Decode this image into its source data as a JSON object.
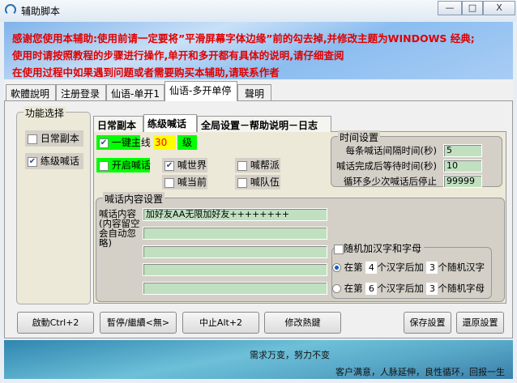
{
  "window": {
    "title": "辅助脚本",
    "minimize": "—",
    "maximize": "□",
    "close": "X"
  },
  "banner": {
    "lines": [
      "感谢您使用本辅助:使用前请一定要将”平滑屏幕字体边缘”前的勾去掉,并修改主题为WINDOWS 经典;",
      "使用时请按照教程的步骤进行操作,单开和多开都有具体的说明,请仔细查阅",
      "在使用过程中如果遇到问题或者需要购买本辅助,请联系作者"
    ]
  },
  "tabs": [
    "軟體說明",
    "注册登录",
    "仙语-单开1",
    "仙语-多开单停",
    "聲明"
  ],
  "func_group": {
    "title": "功能选择",
    "items": [
      {
        "label": "日常副本",
        "checked": false
      },
      {
        "label": "练级喊话",
        "checked": true
      }
    ]
  },
  "inner_tabs": [
    "日常副本",
    "练级喊话",
    "全局设置－帮助说明－日志"
  ],
  "leveling": {
    "main_quest_label": "一键主线",
    "main_quest_checked": true,
    "level_value": "30",
    "level_unit": "级"
  },
  "shout": {
    "enable_label": "开启喊话",
    "enable_checked": false,
    "world": {
      "label": "喊世界",
      "checked": true
    },
    "guild": {
      "label": "喊帮派",
      "checked": false
    },
    "current": {
      "label": "喊当前",
      "checked": false
    },
    "team": {
      "label": "喊队伍",
      "checked": false
    }
  },
  "time_settings": {
    "title": "时间设置",
    "interval_label": "每条喊话间隔时间(秒)",
    "interval_value": "5",
    "wait_label": "喊话完成后等待时间(秒)",
    "wait_value": "10",
    "loop_label": "循环多少次喊话后停止",
    "loop_value": "99999"
  },
  "content_settings": {
    "title": "喊话内容设置",
    "label": "喊话内容(内容留空会自动忽略)",
    "lines": [
      "加好友AA无限加好友++++++++",
      "",
      "",
      "",
      ""
    ]
  },
  "random": {
    "title": "随机加汉字和字母",
    "checked": false,
    "opt1": {
      "prefix": "在第",
      "pos": "4",
      "mid": "个汉字后加",
      "count": "3",
      "suffix": "个随机汉字",
      "selected": true
    },
    "opt2": {
      "prefix": "在第",
      "pos": "6",
      "mid": "个汉字后加",
      "count": "3",
      "suffix": "个随机字母",
      "selected": false
    }
  },
  "buttons": {
    "start": "啟動Ctrl+2",
    "pause": "暫停/繼續<無>",
    "stop": "中止Alt+2",
    "hotkey": "修改熱鍵",
    "save": "保存設置",
    "restore": "還原設置"
  },
  "footer": {
    "line1": "需求万变，努力不变",
    "line2": "客户满意，人脉延伸，良性循环，回报一生"
  }
}
